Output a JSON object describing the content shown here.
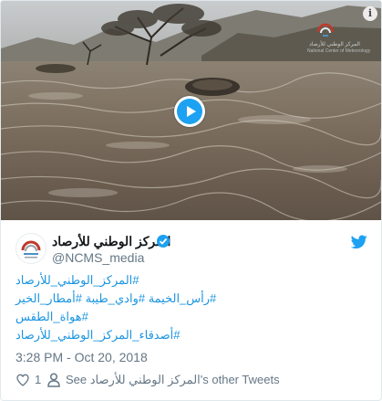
{
  "media": {
    "watermark_line1": "المركز الوطني للأرصاد",
    "watermark_line2": "National Center of Meteorology"
  },
  "author": {
    "name": "المركز الوطني للأرصاد",
    "handle": "@NCMS_media"
  },
  "hashtags": [
    "#المركز_الوطني_للأرصاد",
    "#رأس_الخيمة #وادي_طيبة #أمطار_الخير",
    "#هواة_الطقس",
    "#أصدقاء_المركز_الوطني_للأرصاد"
  ],
  "timestamp": "3:28 PM - Oct 20, 2018",
  "actions": {
    "like_count": "1",
    "see_prefix": "See ",
    "see_name": "المركز الوطني للأرصاد",
    "see_suffix": "'s other Tweets"
  },
  "colors": {
    "link": "#1b95e0",
    "twitter_blue": "#1da1f2",
    "muted": "#657786"
  },
  "icons": [
    "info-icon",
    "play-icon",
    "verified-icon",
    "twitter-bird-icon",
    "heart-icon",
    "user-icon"
  ]
}
